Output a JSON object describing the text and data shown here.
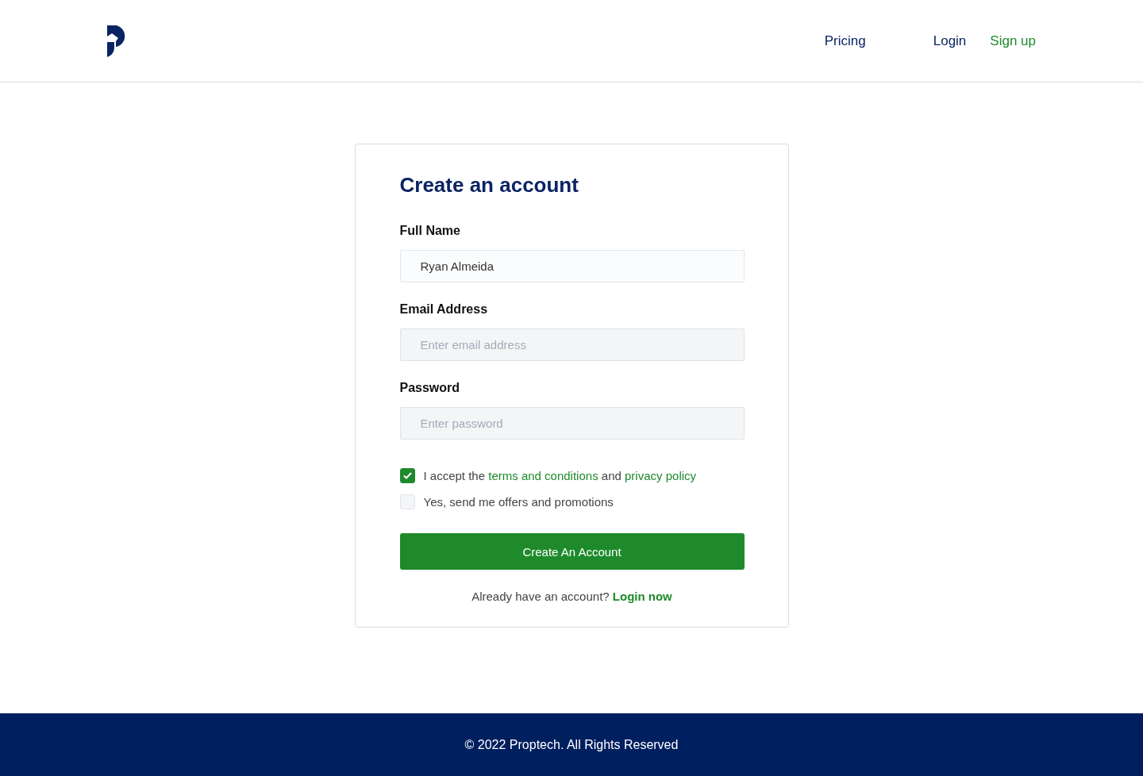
{
  "header": {
    "nav": [
      {
        "label": "Pricing",
        "kind": "plain"
      },
      {
        "label": "Login",
        "kind": "plain"
      },
      {
        "label": "Sign up",
        "kind": "accent"
      }
    ]
  },
  "form": {
    "title": "Create an account",
    "fields": [
      {
        "label": "Full Name",
        "value": "Ryan Almeida"
      },
      {
        "label": "Email Address",
        "placeholder": "Enter email address"
      },
      {
        "label": "Password",
        "placeholder": "Enter password"
      }
    ],
    "checkboxes": [
      {
        "checked": true,
        "parts": [
          {
            "kind": "text",
            "text": "I accept the"
          },
          {
            "kind": "link",
            "text": "terms and conditions"
          },
          {
            "kind": "text",
            "text": "and"
          },
          {
            "kind": "link",
            "text": "privacy policy"
          }
        ]
      },
      {
        "checked": false,
        "parts": [
          {
            "kind": "text",
            "text": "Yes, send me offers and promotions"
          }
        ]
      }
    ],
    "submit": "Create An Account",
    "login_prompt": {
      "text": "Already have an account?",
      "link": "Login now"
    }
  },
  "footer": "© 2022 Proptech. All Rights Reserved"
}
